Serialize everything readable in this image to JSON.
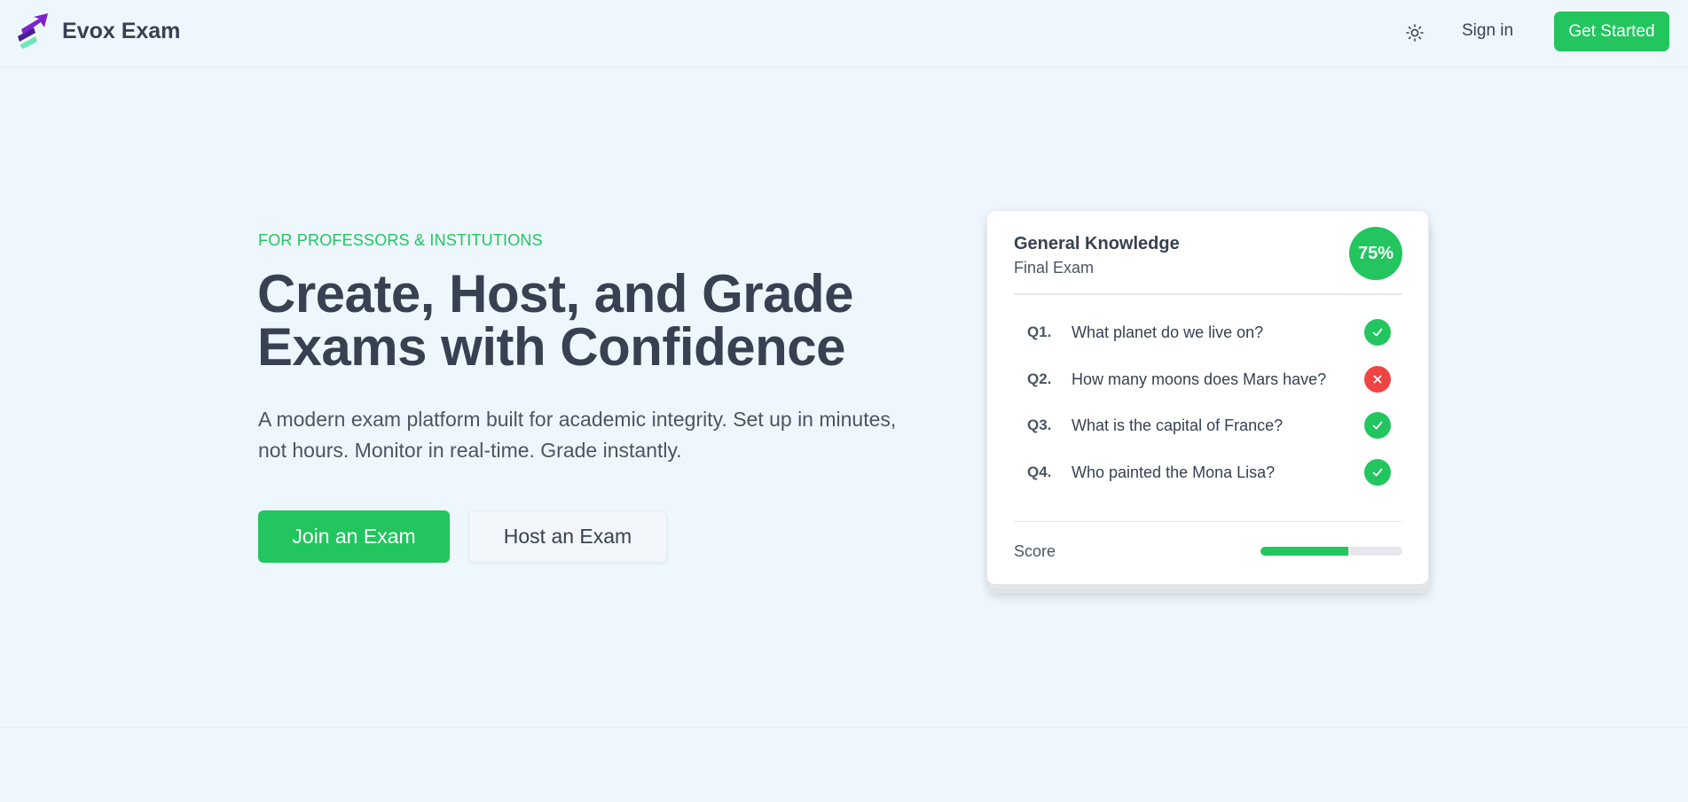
{
  "nav": {
    "brand": "Evox Exam",
    "theme_toggle_icon": "sun-icon",
    "signin_label": "Sign in",
    "get_started_label": "Get Started"
  },
  "hero": {
    "eyebrow": "FOR PROFESSORS & INSTITUTIONS",
    "headline": "Create, Host, and Grade Exams with Confidence",
    "subtext": "A modern exam platform built for academic integrity. Set up in minutes, not hours. Monitor in real-time. Grade instantly.",
    "join_label": "Join an Exam",
    "host_label": "Host an Exam"
  },
  "card": {
    "title": "General Knowledge",
    "subtitle": "Final Exam",
    "score_badge": "75%",
    "questions": [
      {
        "num": "Q1.",
        "text": "What planet do we live on?",
        "status": "correct"
      },
      {
        "num": "Q2.",
        "text": "How many moons does Mars have?",
        "status": "wrong"
      },
      {
        "num": "Q3.",
        "text": "What is the capital of France?",
        "status": "correct"
      },
      {
        "num": "Q4.",
        "text": "Who painted the Mona Lisa?",
        "status": "correct"
      }
    ],
    "score_label": "Score",
    "score_progress": 0.62
  },
  "colors": {
    "accent": "#22c55e",
    "error": "#ef4444",
    "background": "#eff7fe",
    "text": "#374151"
  }
}
